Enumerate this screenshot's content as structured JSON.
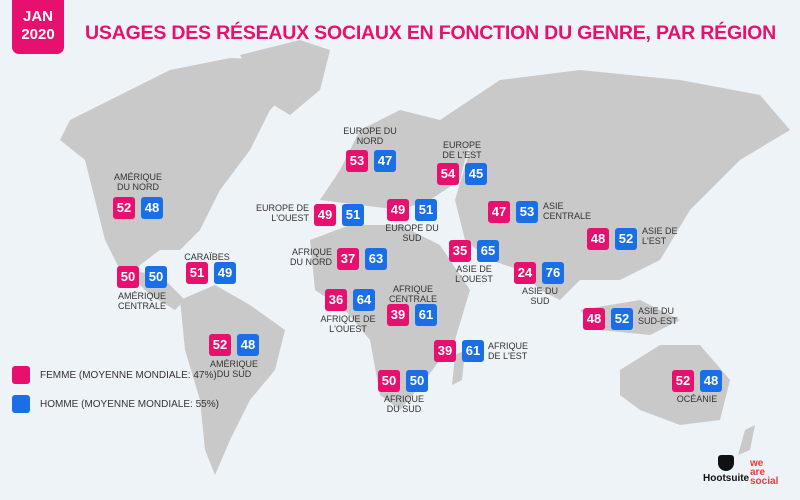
{
  "header": {
    "date_badge": "JAN\n2020",
    "title": "USAGES DES RÉSEAUX SOCIAUX EN FONCTION DU GENRE, PAR RÉGION"
  },
  "colors": {
    "femme": "#e8106e",
    "homme": "#1a6fe6",
    "land": "#c9c9c9",
    "background": "#eef3f8"
  },
  "legend": [
    {
      "label": "FEMME (MOYENNE MONDIALE: 47%)",
      "color": "#e8106e"
    },
    {
      "label": "HOMME (MOYENNE MONDIALE: 55%)",
      "color": "#1a6fe6"
    }
  ],
  "regions": [
    {
      "name": "AMÉRIQUE\nDU NORD",
      "femme": 52,
      "homme": 48
    },
    {
      "name": "AMÉRIQUE\nCENTRALE",
      "femme": 50,
      "homme": 50
    },
    {
      "name": "CARAÏBES",
      "femme": 51,
      "homme": 49
    },
    {
      "name": "AMÉRIQUE\nDU SUD",
      "femme": 52,
      "homme": 48
    },
    {
      "name": "EUROPE DU\nNORD",
      "femme": 53,
      "homme": 47
    },
    {
      "name": "EUROPE DE\nL'OUEST",
      "femme": 49,
      "homme": 51
    },
    {
      "name": "EUROPE DU\nSUD",
      "femme": 49,
      "homme": 51
    },
    {
      "name": "EUROPE\nDE L'EST",
      "femme": 54,
      "homme": 45
    },
    {
      "name": "AFRIQUE\nDU NORD",
      "femme": 37,
      "homme": 63
    },
    {
      "name": "AFRIQUE DE\nL'OUEST",
      "femme": 36,
      "homme": 64
    },
    {
      "name": "AFRIQUE\nCENTRALE",
      "femme": 39,
      "homme": 61
    },
    {
      "name": "AFRIQUE\nDE L'EST",
      "femme": 39,
      "homme": 61
    },
    {
      "name": "AFRIQUE\nDU SUD",
      "femme": 50,
      "homme": 50
    },
    {
      "name": "ASIE\nCENTRALE",
      "femme": 47,
      "homme": 53
    },
    {
      "name": "ASIE DE\nL'OUEST",
      "femme": 35,
      "homme": 65
    },
    {
      "name": "ASIE DU\nSUD",
      "femme": 24,
      "homme": 76
    },
    {
      "name": "ASIE DE\nL'EST",
      "femme": 48,
      "homme": 52
    },
    {
      "name": "ASIE DU\nSUD-EST",
      "femme": 48,
      "homme": 52
    },
    {
      "name": "OCÉANIE",
      "femme": 52,
      "homme": 48
    }
  ],
  "logos": {
    "hootsuite": "Hootsuite",
    "we_are_social": "we\nare\nsocial"
  }
}
